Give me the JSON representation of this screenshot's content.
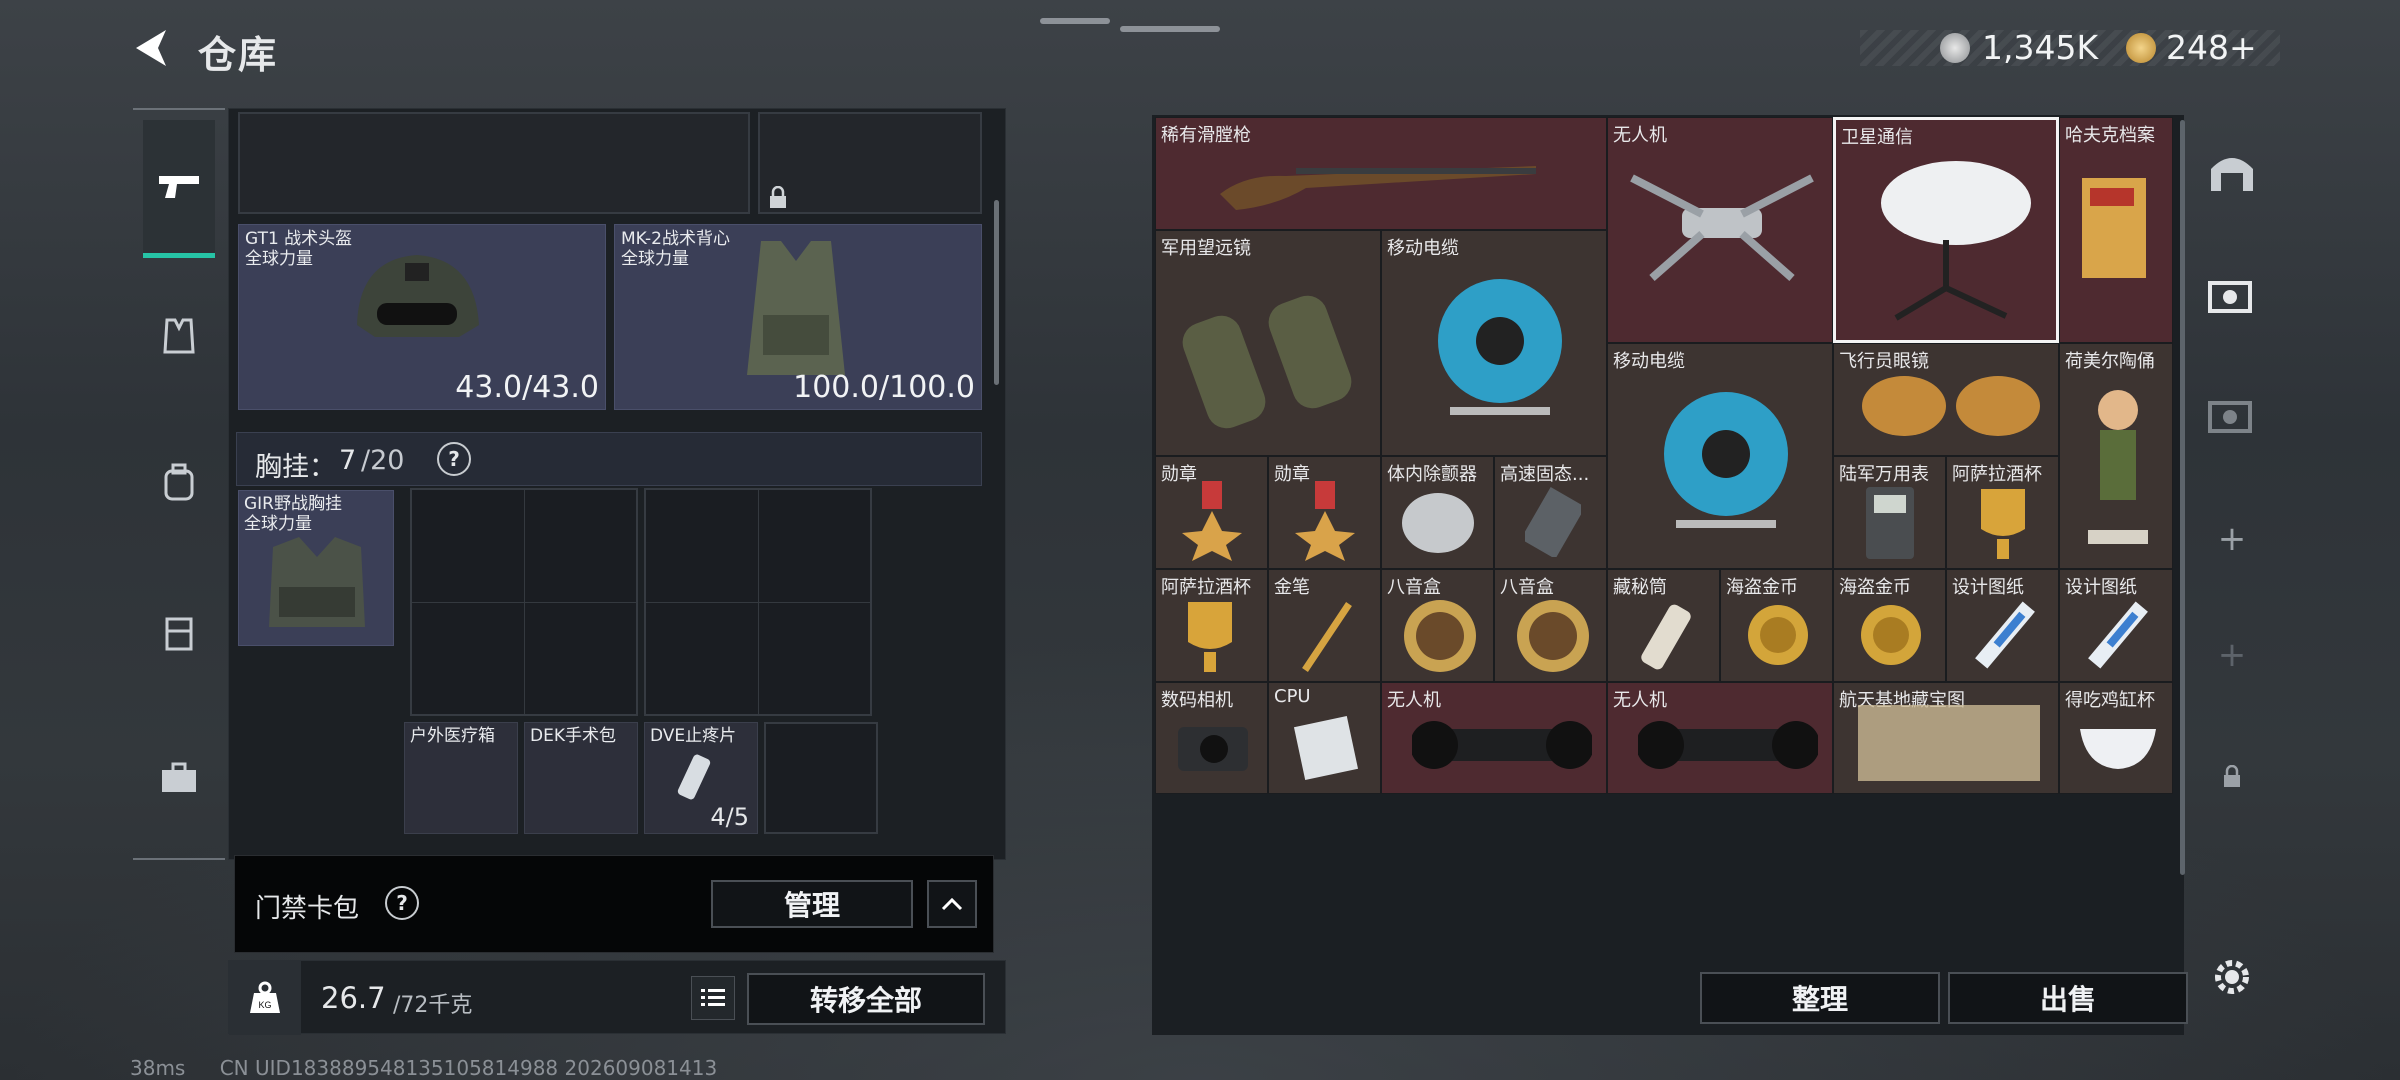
{
  "header": {
    "title": "仓库",
    "currency_money": "1,345K",
    "currency_gold": "248+"
  },
  "left_tabs": [
    "pistol-icon",
    "vest-icon",
    "backpack-icon",
    "case-icon",
    "toolbox-icon"
  ],
  "equip": {
    "helmet": {
      "name": "GT1 战术头盔",
      "sub": "全球力量",
      "durability": "43.0/43.0"
    },
    "armor": {
      "name": "MK-2战术背心",
      "sub": "全球力量",
      "durability": "100.0/100.0"
    }
  },
  "chest_rig": {
    "label": "胸挂：",
    "used": "7",
    "capacity": "/20",
    "help": "?",
    "item_name": "GIR野战胸挂",
    "item_sub": "全球力量"
  },
  "rig_items": [
    {
      "name": "户外医疗箱"
    },
    {
      "name": "DEK手术包"
    },
    {
      "name": "DVE止疼片",
      "count": "4/5"
    }
  ],
  "keycase": {
    "label": "门禁卡包",
    "help": "?",
    "manage": "管理"
  },
  "weight": {
    "value": "26.7",
    "unit": "/72千克",
    "transfer_all": "转移全部"
  },
  "stash_items": [
    {
      "name": "稀有滑膛枪",
      "color": "red"
    },
    {
      "name": "无人机",
      "color": "red"
    },
    {
      "name": "卫星通信",
      "color": "red",
      "selected": true
    },
    {
      "name": "哈夫克档案",
      "color": "red"
    },
    {
      "name": "军用望远镜",
      "color": "brown"
    },
    {
      "name": "移动电缆",
      "color": "brown"
    },
    {
      "name": "移动电缆",
      "color": "brown"
    },
    {
      "name": "飞行员眼镜",
      "color": "brown"
    },
    {
      "name": "荷美尔陶俑",
      "color": "brown"
    },
    {
      "name": "勋章",
      "color": "brown"
    },
    {
      "name": "勋章",
      "color": "brown"
    },
    {
      "name": "体内除颤器",
      "color": "brown"
    },
    {
      "name": "高速固态...",
      "color": "brown"
    },
    {
      "name": "陆军万用表",
      "color": "brown"
    },
    {
      "name": "阿萨拉酒杯",
      "color": "brown"
    },
    {
      "name": "阿萨拉酒杯",
      "color": "brown"
    },
    {
      "name": "金笔",
      "color": "brown"
    },
    {
      "name": "八音盒",
      "color": "brown"
    },
    {
      "name": "八音盒",
      "color": "brown"
    },
    {
      "name": "藏秘筒",
      "color": "brown"
    },
    {
      "name": "海盗金币",
      "color": "brown"
    },
    {
      "name": "海盗金币",
      "color": "brown"
    },
    {
      "name": "设计图纸",
      "color": "brown"
    },
    {
      "name": "设计图纸",
      "color": "brown"
    },
    {
      "name": "数码相机",
      "color": "brown"
    },
    {
      "name": "CPU",
      "color": "brown"
    },
    {
      "name": "无人机",
      "color": "red"
    },
    {
      "name": "无人机",
      "color": "red"
    },
    {
      "name": "航天基地藏宝图",
      "color": "brown"
    },
    {
      "name": "得吃鸡缸杯",
      "color": "brown"
    }
  ],
  "actions": {
    "sort": "整理",
    "sell": "出售"
  },
  "status_bar": {
    "ping": "38ms",
    "uid": "CN UID183889548135105814988 202609081413"
  },
  "colors": {
    "accent": "#26c4a6",
    "rare_red": "#4e2a30",
    "cell_brown": "#3d3431"
  }
}
